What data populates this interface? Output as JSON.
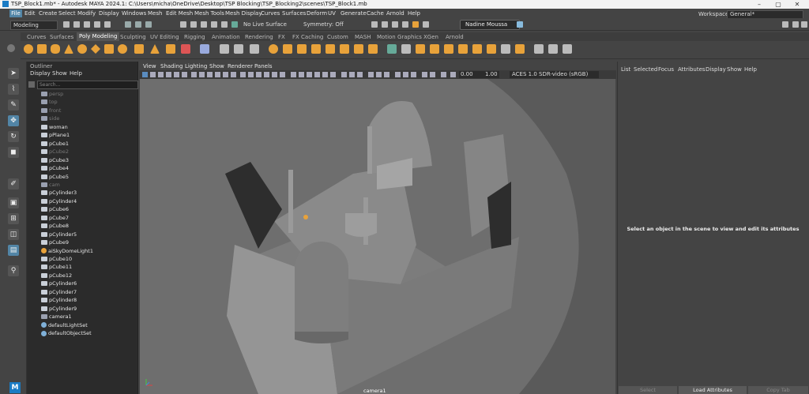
{
  "window": {
    "title": "TSP_Block1.mb* - Autodesk MAYA 2024.1: C:\\Users\\micha\\OneDrive\\Desktop\\TSP Blocking\\TSP_Blocking2\\scenes\\TSP_Block1.mb",
    "minimize": "–",
    "maximize": "▢",
    "close": "✕"
  },
  "menubar": {
    "items": [
      "File",
      "Edit",
      "Create",
      "Select",
      "Modify",
      "Display",
      "Windows",
      "Mesh",
      "Edit Mesh",
      "Mesh Tools",
      "Mesh Display",
      "Curves",
      "Surfaces",
      "Deform",
      "UV",
      "Generate",
      "Cache",
      "Arnold",
      "Help"
    ],
    "workspace_label": "Workspace:",
    "workspace_value": "General*"
  },
  "statusline": {
    "mode": "Modeling",
    "live_surface": "No Live Surface",
    "symmetry": "Symmetry: Off",
    "user": "Nadine Moussa"
  },
  "shelf": {
    "tabs": [
      "Curves",
      "Surfaces",
      "Poly Modeling",
      "Sculpting",
      "UV Editing",
      "Rigging",
      "Animation",
      "Rendering",
      "FX",
      "FX Caching",
      "Custom",
      "MASH",
      "Motion Graphics",
      "XGen",
      "Arnold"
    ],
    "active_tab": "Poly Modeling"
  },
  "outliner": {
    "title": "Outliner",
    "menus": [
      "Display",
      "Show",
      "Help"
    ],
    "search_placeholder": "Search...",
    "items": [
      {
        "label": "persp",
        "type": "camera",
        "dim": true
      },
      {
        "label": "top",
        "type": "camera",
        "dim": true
      },
      {
        "label": "front",
        "type": "camera",
        "dim": true
      },
      {
        "label": "side",
        "type": "camera",
        "dim": true
      },
      {
        "label": "woman",
        "type": "mesh",
        "dim": false
      },
      {
        "label": "pPlane1",
        "type": "mesh",
        "dim": false
      },
      {
        "label": "pCube1",
        "type": "mesh",
        "dim": false
      },
      {
        "label": "pCube2",
        "type": "mesh",
        "dim": true
      },
      {
        "label": "pCube3",
        "type": "mesh",
        "dim": false
      },
      {
        "label": "pCube4",
        "type": "mesh",
        "dim": false
      },
      {
        "label": "pCube5",
        "type": "mesh",
        "dim": false
      },
      {
        "label": "cam",
        "type": "camera",
        "dim": true
      },
      {
        "label": "pCylinder3",
        "type": "mesh",
        "dim": false
      },
      {
        "label": "pCylinder4",
        "type": "mesh",
        "dim": false
      },
      {
        "label": "pCube6",
        "type": "mesh",
        "dim": false
      },
      {
        "label": "pCube7",
        "type": "mesh",
        "dim": false
      },
      {
        "label": "pCube8",
        "type": "mesh",
        "dim": false
      },
      {
        "label": "pCylinder5",
        "type": "mesh",
        "dim": false
      },
      {
        "label": "pCube9",
        "type": "mesh",
        "dim": false
      },
      {
        "label": "aiSkyDomeLight1",
        "type": "light",
        "dim": false
      },
      {
        "label": "pCube10",
        "type": "mesh",
        "dim": false
      },
      {
        "label": "pCube11",
        "type": "mesh",
        "dim": false
      },
      {
        "label": "pCube12",
        "type": "mesh",
        "dim": false
      },
      {
        "label": "pCylinder6",
        "type": "mesh",
        "dim": false
      },
      {
        "label": "pCylinder7",
        "type": "mesh",
        "dim": false
      },
      {
        "label": "pCylinder8",
        "type": "mesh",
        "dim": false
      },
      {
        "label": "pCylinder9",
        "type": "mesh",
        "dim": false
      },
      {
        "label": "camera1",
        "type": "camera",
        "dim": false
      },
      {
        "label": "defaultLightSet",
        "type": "set",
        "dim": false
      },
      {
        "label": "defaultObjectSet",
        "type": "set",
        "dim": false
      }
    ]
  },
  "viewport": {
    "menus": [
      "View",
      "Shading",
      "Lighting",
      "Show",
      "Renderer",
      "Panels"
    ],
    "field1": "0.00",
    "field2": "1.00",
    "colorspace": "ACES 1.0 SDR-video (sRGB)",
    "camera_label": "camera1"
  },
  "attributes": {
    "menus": [
      "List",
      "Selected",
      "Focus",
      "Attributes",
      "Display",
      "Show",
      "Help"
    ],
    "empty_message": "Select an object in the scene to view and edit its attributes",
    "buttons": [
      "Select",
      "Load Attributes",
      "Copy Tab"
    ]
  },
  "badge": "M",
  "colors": {
    "accent": "#5285a6",
    "icon_orange": "#e8a23a"
  }
}
